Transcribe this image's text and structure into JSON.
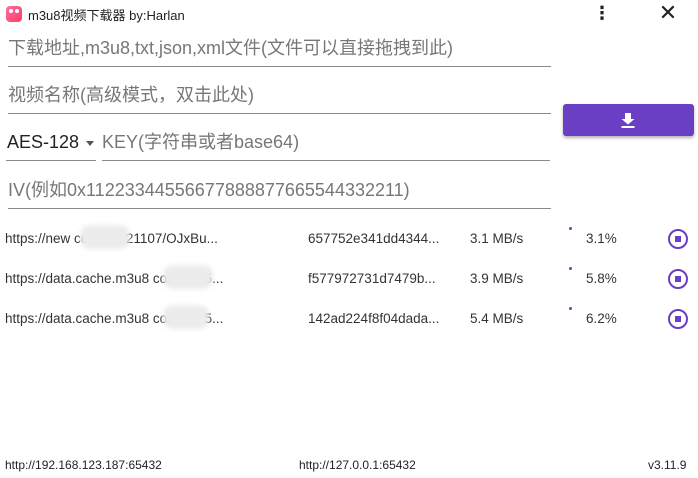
{
  "window": {
    "title": "m3u8视频下载器 by:Harlan",
    "menu_glyph": "⋮",
    "close_glyph": "✕"
  },
  "form": {
    "url_placeholder": "下载地址,m3u8,txt,json,xml文件(文件可以直接拖拽到此)",
    "name_placeholder": "视频名称(高级模式，双击此处)",
    "encryption_selected": "AES-128",
    "key_placeholder": "KEY(字符串或者base64)",
    "iv_placeholder": "IV(例如0x11223344556677888877665544332211)"
  },
  "download_button_icon": "download-icon",
  "tasks": [
    {
      "url": "https://new           com/20221107/OJxBu...",
      "hash": "657752e341dd4344...",
      "speed": "3.1 MB/s",
      "percent": "3.1%"
    },
    {
      "url": "https://data.cache.m3u8           com:3395...",
      "hash": "f577972731d7479b...",
      "speed": "3.9 MB/s",
      "percent": "5.8%"
    },
    {
      "url": "https://data.cache.m3u8           com:3395...",
      "hash": "142ad224f8f04dada...",
      "speed": "5.4 MB/s",
      "percent": "6.2%"
    }
  ],
  "footer": {
    "left": "http://192.168.123.187:65432",
    "middle": "http://127.0.0.1:65432",
    "version": "v3.11.9"
  },
  "colors": {
    "accent": "#6a3fc4"
  }
}
